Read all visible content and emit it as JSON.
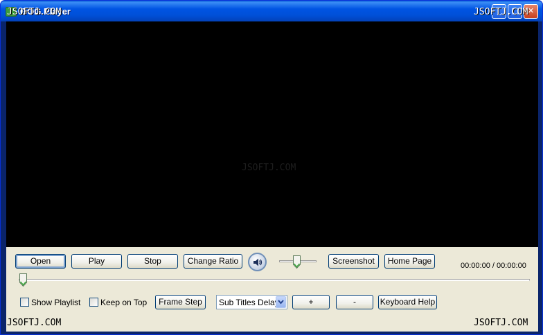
{
  "window": {
    "title": "GOG Player",
    "min_glyph": "_",
    "max_glyph": "□",
    "close_glyph": "✕"
  },
  "watermarks": {
    "top_left": "JSOFTJ.COM",
    "top_right": "JSOFTJ.COM",
    "center": "JSOFTJ.COM",
    "bottom_left": "JSOFTJ.COM",
    "bottom_right": "JSOFTJ.COM"
  },
  "controls": {
    "open": "Open",
    "play": "Play",
    "stop": "Stop",
    "change_ratio": "Change Ratio",
    "screenshot": "Screenshot",
    "home_page": "Home Page",
    "time": "00:00:00 / 00:00:00",
    "volume_fraction": 0.5,
    "seek_fraction": 0.0
  },
  "options": {
    "show_playlist": "Show Playlist",
    "show_playlist_checked": false,
    "keep_on_top": "Keep on Top",
    "keep_on_top_checked": false,
    "frame_step": "Frame Step",
    "subtitle_select_value": "Sub Titles Delay",
    "plus": "+",
    "minus": "-",
    "keyboard_help": "Keyboard Help"
  },
  "icons": {
    "speaker": "speaker-icon",
    "app": "app-icon"
  }
}
